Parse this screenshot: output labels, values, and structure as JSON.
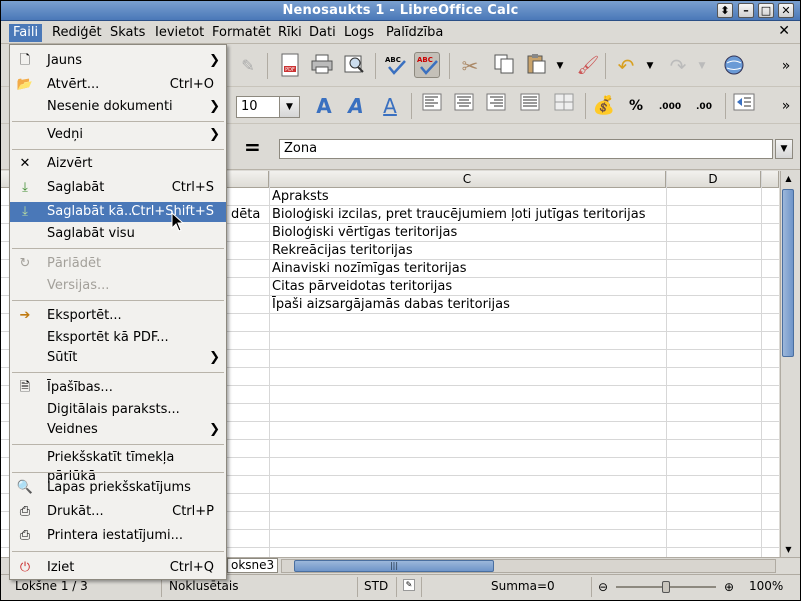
{
  "window": {
    "title": "Nenosaukts 1 - LibreOffice Calc",
    "controls": [
      "⬍",
      "–",
      "□",
      "✕"
    ]
  },
  "menubar": {
    "items": [
      "Faili",
      "Rediģēt",
      "Skats",
      "Ievietot",
      "Formatēt",
      "Rīki",
      "Dati",
      "Logs",
      "Palīdzība"
    ],
    "active": "Faili",
    "close": "✕"
  },
  "toolbar": {
    "font_size": "10",
    "percent": "%",
    "decimal_add": ".000",
    "decimal_remove": ".00"
  },
  "formula_bar": {
    "eq": "=",
    "value": "Zona"
  },
  "grid": {
    "columns": [
      "C",
      "D"
    ],
    "partial_cell": "dēta",
    "rows": [
      "Apraksts",
      "Bioloģiski izcilas, pret traucējumiem ļoti jutīgas teritorijas",
      "Bioloģiski vērtīgas teritorijas",
      "Rekreācijas teritorijas",
      "Ainaviski nozīmīgas teritorijas",
      "Citas pārveidotas teritorijas",
      "Īpaši aizsargājamās dabas teritorijas"
    ]
  },
  "sheet_tab": "oksne3",
  "statusbar": {
    "sheet": "Lokšne 1 / 3",
    "style": "Noklusētais",
    "mode": "STD",
    "sum": "Summa=0",
    "zoom": "100%",
    "zoom_level": 100
  },
  "file_menu": {
    "items": [
      {
        "label": "Jauns",
        "shortcut": "",
        "submenu": true,
        "icon": "new-doc-icon",
        "glyph": "🗋",
        "state": "normal"
      },
      {
        "label": "Atvērt...",
        "shortcut": "Ctrl+O",
        "submenu": false,
        "icon": "open-folder-icon",
        "glyph": "📂",
        "state": "normal"
      },
      {
        "label": "Nesenie dokumenti",
        "shortcut": "",
        "submenu": true,
        "icon": "",
        "glyph": "",
        "state": "normal"
      },
      {
        "label": "Vedņi",
        "shortcut": "",
        "submenu": true,
        "icon": "",
        "glyph": "",
        "state": "normal"
      },
      {
        "label": "Aizvērt",
        "shortcut": "",
        "submenu": false,
        "icon": "close-x-icon",
        "glyph": "✕",
        "state": "normal"
      },
      {
        "label": "Saglabāt",
        "shortcut": "Ctrl+S",
        "submenu": false,
        "icon": "save-icon",
        "glyph": "⤓",
        "state": "normal"
      },
      {
        "label": "Saglabāt kā...",
        "shortcut": "Ctrl+Shift+S",
        "submenu": false,
        "icon": "save-as-icon",
        "glyph": "⤓",
        "state": "highlighted"
      },
      {
        "label": "Saglabāt visu",
        "shortcut": "",
        "submenu": false,
        "icon": "",
        "glyph": "",
        "state": "normal"
      },
      {
        "label": "Pārlādēt",
        "shortcut": "",
        "submenu": false,
        "icon": "reload-icon",
        "glyph": "↻",
        "state": "disabled"
      },
      {
        "label": "Versijas...",
        "shortcut": "",
        "submenu": false,
        "icon": "",
        "glyph": "",
        "state": "disabled"
      },
      {
        "label": "Eksportēt...",
        "shortcut": "",
        "submenu": false,
        "icon": "export-icon",
        "glyph": "➔",
        "state": "normal"
      },
      {
        "label": "Eksportēt kā PDF...",
        "shortcut": "",
        "submenu": false,
        "icon": "",
        "glyph": "",
        "state": "normal"
      },
      {
        "label": "Sūtīt",
        "shortcut": "",
        "submenu": true,
        "icon": "",
        "glyph": "",
        "state": "normal"
      },
      {
        "label": "Īpašības...",
        "shortcut": "",
        "submenu": false,
        "icon": "properties-icon",
        "glyph": "🗎",
        "state": "normal"
      },
      {
        "label": "Digitālais paraksts...",
        "shortcut": "",
        "submenu": false,
        "icon": "",
        "glyph": "",
        "state": "normal"
      },
      {
        "label": "Veidnes",
        "shortcut": "",
        "submenu": true,
        "icon": "",
        "glyph": "",
        "state": "normal"
      },
      {
        "label": "Priekšskatīt tīmekļa pārlūkā",
        "shortcut": "",
        "submenu": false,
        "icon": "",
        "glyph": "",
        "state": "normal"
      },
      {
        "label": "Lapas priekšskatījums",
        "shortcut": "",
        "submenu": false,
        "icon": "page-preview-icon",
        "glyph": "🔍",
        "state": "normal"
      },
      {
        "label": "Drukāt...",
        "shortcut": "Ctrl+P",
        "submenu": false,
        "icon": "print-icon",
        "glyph": "⎙",
        "state": "normal"
      },
      {
        "label": "Printera iestatījumi...",
        "shortcut": "",
        "submenu": false,
        "icon": "printer-settings-icon",
        "glyph": "⎙",
        "state": "normal"
      },
      {
        "label": "Iziet",
        "shortcut": "Ctrl+Q",
        "submenu": false,
        "icon": "exit-icon",
        "glyph": "⏻",
        "state": "normal"
      }
    ]
  }
}
